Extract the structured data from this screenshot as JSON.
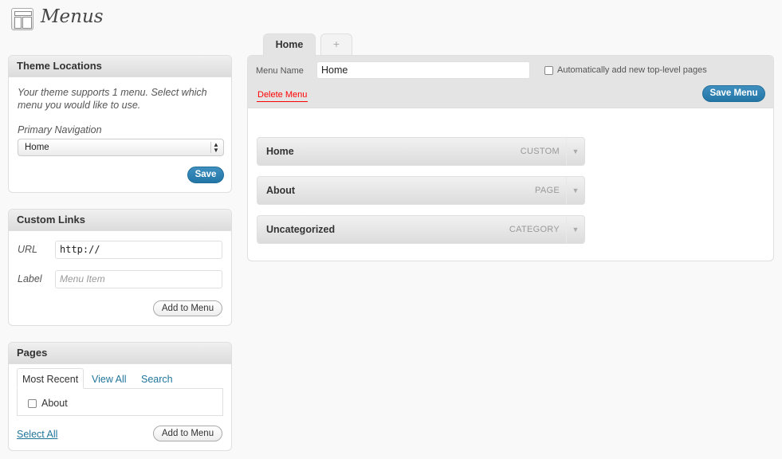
{
  "page": {
    "title": "Menus",
    "icon": "menus-icon"
  },
  "theme_locations": {
    "heading": "Theme Locations",
    "description": "Your theme supports 1 menu. Select which menu you would like to use.",
    "primary_label": "Primary Navigation",
    "primary_value": "Home",
    "save_label": "Save"
  },
  "custom_links": {
    "heading": "Custom Links",
    "url_label": "URL",
    "url_value": "http://",
    "label_label": "Label",
    "label_placeholder": "Menu Item",
    "add_label": "Add to Menu"
  },
  "pages": {
    "heading": "Pages",
    "tabs": [
      "Most Recent",
      "View All",
      "Search"
    ],
    "items": [
      {
        "label": "About",
        "checked": false
      }
    ],
    "select_all_label": "Select All",
    "add_label": "Add to Menu"
  },
  "editor": {
    "tabs": {
      "home": "Home",
      "add": "+"
    },
    "menu_name_label": "Menu Name",
    "menu_name_value": "Home",
    "auto_add_label": "Automatically add new top-level pages",
    "auto_add_checked": false,
    "delete_label": "Delete Menu",
    "save_label": "Save Menu",
    "items": [
      {
        "title": "Home",
        "type": "CUSTOM"
      },
      {
        "title": "About",
        "type": "PAGE"
      },
      {
        "title": "Uncategorized",
        "type": "CATEGORY"
      }
    ]
  },
  "colors": {
    "primary_button": "#2276a6",
    "link": "#21759b",
    "delete_link": "#ff0000"
  }
}
